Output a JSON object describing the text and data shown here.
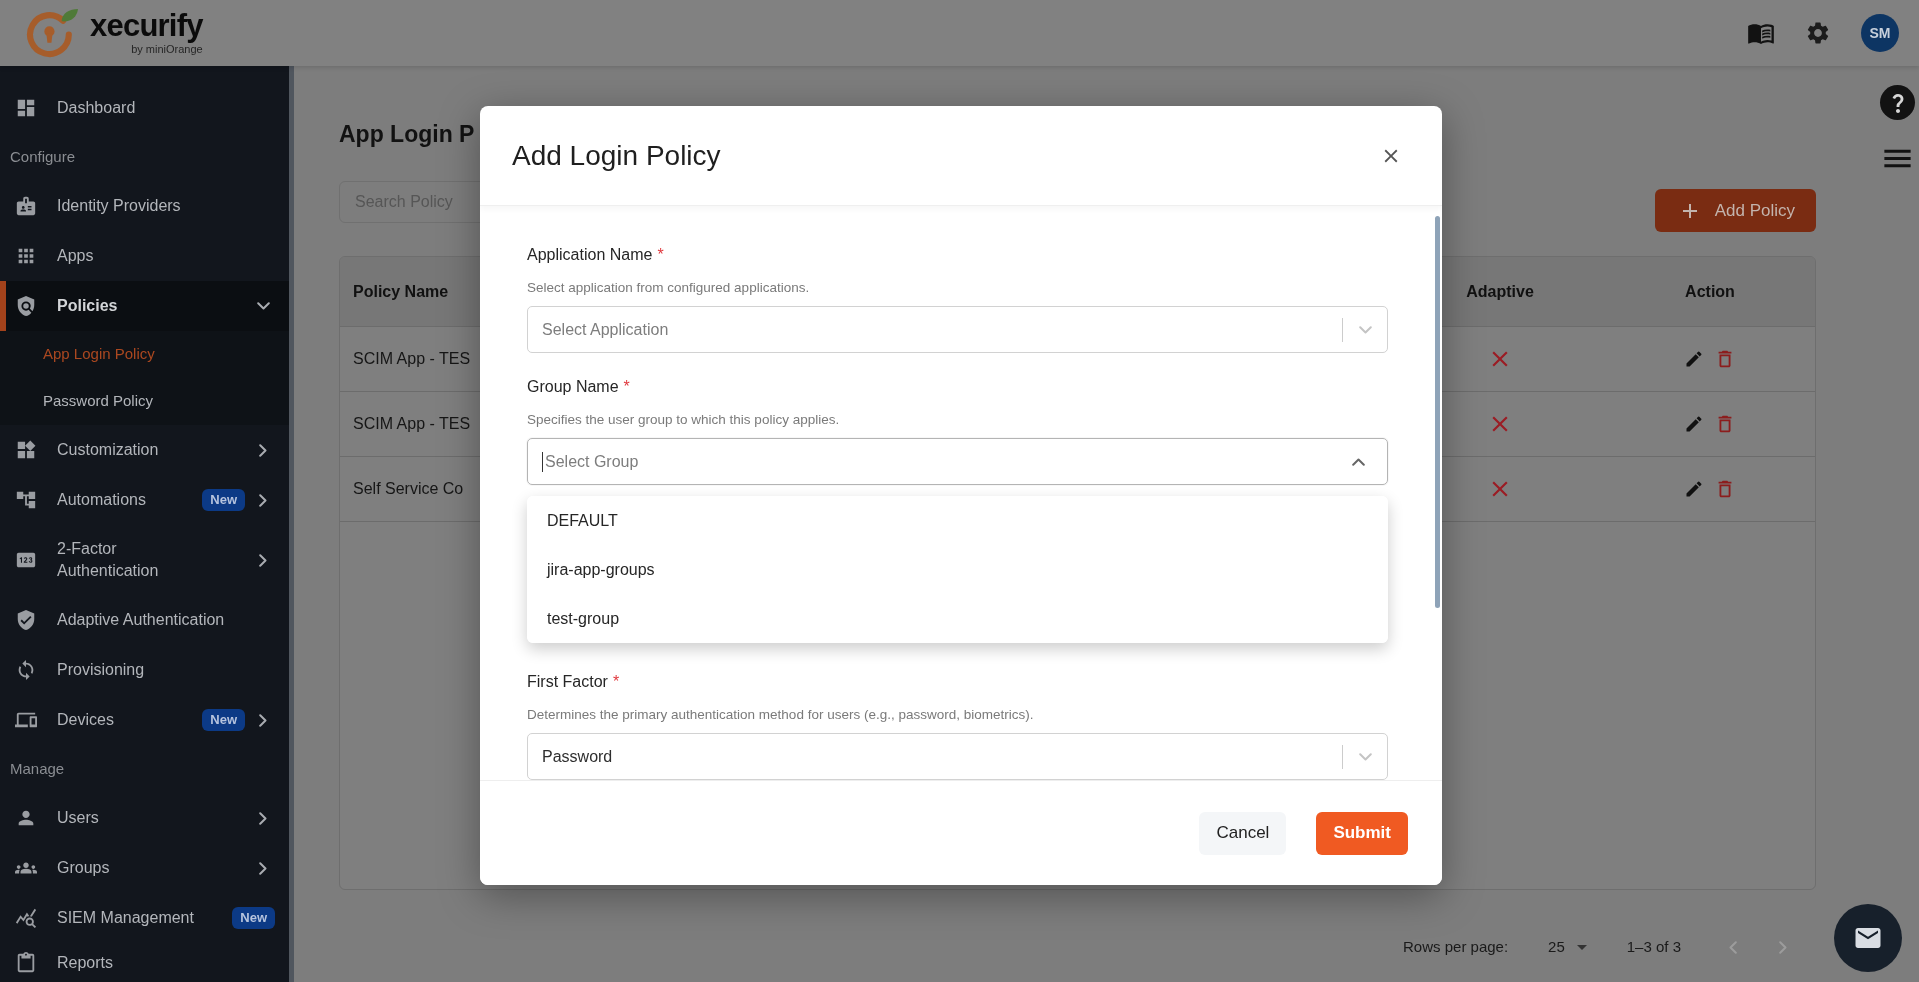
{
  "header": {
    "logo": {
      "name": "xecurify",
      "byline": "by miniOrange"
    },
    "avatar": {
      "initials": "SM"
    }
  },
  "sidebar": {
    "items": [
      {
        "kind": "item",
        "label": "Dashboard",
        "selected": false
      },
      {
        "kind": "section",
        "label": "Configure"
      },
      {
        "kind": "item",
        "label": "Identity Providers",
        "selected": false
      },
      {
        "kind": "item",
        "label": "Apps",
        "selected": false
      },
      {
        "kind": "item",
        "label": "Policies",
        "selected": true,
        "expanded": true,
        "children": [
          {
            "label": "App Login Policy",
            "selected": true
          },
          {
            "label": "Password Policy",
            "selected": false
          }
        ]
      },
      {
        "kind": "item",
        "label": "Customization",
        "selected": false,
        "expanded": false
      },
      {
        "kind": "item",
        "label": "Automations",
        "badge": "New",
        "selected": false,
        "expanded": false
      },
      {
        "kind": "item",
        "label": "2-Factor Authentication",
        "selected": false,
        "expanded": false
      },
      {
        "kind": "item",
        "label": "Adaptive Authentication",
        "selected": false
      },
      {
        "kind": "item",
        "label": "Provisioning",
        "selected": false
      },
      {
        "kind": "item",
        "label": "Devices",
        "badge": "New",
        "selected": false,
        "expanded": false
      },
      {
        "kind": "section",
        "label": "Manage"
      },
      {
        "kind": "item",
        "label": "Users",
        "selected": false,
        "expanded": false
      },
      {
        "kind": "item",
        "label": "Groups",
        "selected": false,
        "expanded": false
      },
      {
        "kind": "item",
        "label": "SIEM Management",
        "badge": "New",
        "selected": false
      },
      {
        "kind": "item",
        "label": "Reports",
        "selected": false
      }
    ]
  },
  "page": {
    "title": "App Login P",
    "search": {
      "placeholder": "Search Policy"
    },
    "add_button": {
      "label": "Add Policy"
    },
    "table": {
      "columns": [
        "Policy Name",
        "Adaptive",
        "Action"
      ],
      "rows": [
        {
          "policy_name": "SCIM App - TES",
          "adaptive": false
        },
        {
          "policy_name": "SCIM App - TES",
          "adaptive": false
        },
        {
          "policy_name": "Self Service Co",
          "adaptive": false
        }
      ]
    },
    "pagination": {
      "rows_per_page_label": "Rows per page:",
      "rows_per_page": "25",
      "range": "1–3 of 3",
      "previous": {
        "disabled": true
      },
      "next": {
        "disabled": true
      }
    }
  },
  "dialog": {
    "title": "Add Login Policy",
    "fields": [
      {
        "label": "Application Name",
        "required_mark": "*",
        "help": "Select application from configured applications.",
        "placeholder": "Select Application",
        "open": false,
        "focused": false
      },
      {
        "label": "Group Name",
        "required_mark": "*",
        "help": "Specifies the user group to which this policy applies.",
        "placeholder": "Select Group",
        "open": true,
        "focused": true,
        "options": [
          {
            "label": "DEFAULT",
            "selected": false
          },
          {
            "label": "jira-app-groups",
            "selected": false
          },
          {
            "label": "test-group",
            "selected": false
          }
        ]
      },
      {
        "label": "First Factor",
        "required_mark": "*",
        "help": "Determines the primary authentication method for users (e.g., password, biometrics).",
        "value": "Password",
        "open": false,
        "focused": false
      }
    ],
    "buttons": [
      {
        "label": "Cancel",
        "kind": "secondary"
      },
      {
        "label": "Submit",
        "kind": "primary"
      }
    ]
  }
}
